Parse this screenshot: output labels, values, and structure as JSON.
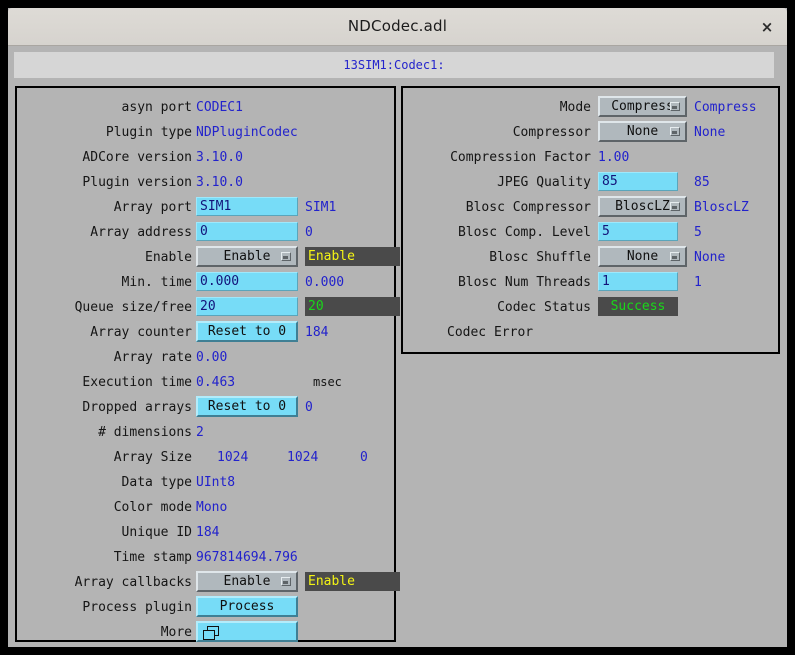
{
  "window": {
    "title": "NDCodec.adl",
    "close_label": "×",
    "macro": "13SIM1:Codec1:"
  },
  "left_panel": {
    "rows": [
      {
        "label": "asyn port",
        "value": "CODEC1"
      },
      {
        "label": "Plugin type",
        "value": "NDPluginCodec"
      },
      {
        "label": "ADCore version",
        "value": "3.10.0"
      },
      {
        "label": "Plugin version",
        "value": "3.10.0"
      },
      {
        "label": "Array port",
        "entry": "SIM1",
        "value": "SIM1"
      },
      {
        "label": "Array address",
        "entry": "0",
        "value": "0"
      },
      {
        "label": "Enable",
        "menu": "Enable",
        "monitor": "Enable"
      },
      {
        "label": "Min. time",
        "entry": "0.000",
        "value": "0.000"
      },
      {
        "label": "Queue size/free",
        "entry": "20",
        "monitor": "20"
      },
      {
        "label": "Array counter",
        "button": "Reset to 0",
        "value": "184"
      },
      {
        "label": "Array rate",
        "value": "0.00"
      },
      {
        "label": "Execution time",
        "value": "0.463",
        "units": "msec"
      },
      {
        "label": "Dropped arrays",
        "button": "Reset to 0",
        "value": "0"
      },
      {
        "label": "# dimensions",
        "value": "2"
      },
      {
        "label": "Array Size",
        "value": "1024",
        "value2": "1024",
        "value3": "0"
      },
      {
        "label": "Data type",
        "value": "UInt8"
      },
      {
        "label": "Color mode",
        "value": "Mono"
      },
      {
        "label": "Unique ID",
        "value": "184"
      },
      {
        "label": "Time stamp",
        "value": "967814694.796"
      },
      {
        "label": "Array callbacks",
        "menu": "Enable",
        "monitor": "Enable"
      },
      {
        "label": "Process plugin",
        "button": "Process"
      },
      {
        "label": "More",
        "button": ""
      }
    ]
  },
  "right_panel": {
    "rows": [
      {
        "label": "Mode",
        "menu": "Compress",
        "value": "Compress"
      },
      {
        "label": "Compressor",
        "menu": "None",
        "value": "None"
      },
      {
        "label": "Compression Factor",
        "value": "1.00"
      },
      {
        "label": "JPEG Quality",
        "entry": "85",
        "value": "85"
      },
      {
        "label": "Blosc Compressor",
        "menu": "BloscLZ",
        "value": "BloscLZ"
      },
      {
        "label": "Blosc Comp. Level",
        "entry": "5",
        "value": "5"
      },
      {
        "label": "Blosc Shuffle",
        "menu": "None",
        "value": "None"
      },
      {
        "label": "Blosc Num Threads",
        "entry": "1",
        "value": "1"
      },
      {
        "label": "Codec Status",
        "monitor": "Success"
      },
      {
        "label": "Codec Error",
        "standalone": true
      }
    ]
  },
  "colors": {
    "window_bg": "#b4b4b4",
    "entry_bg": "#77dcf7",
    "monitor_bg": "#4a4a4a",
    "readback_text": "#2222cc",
    "status_ok": "#19d819",
    "alarm_text": "#f4f414"
  }
}
